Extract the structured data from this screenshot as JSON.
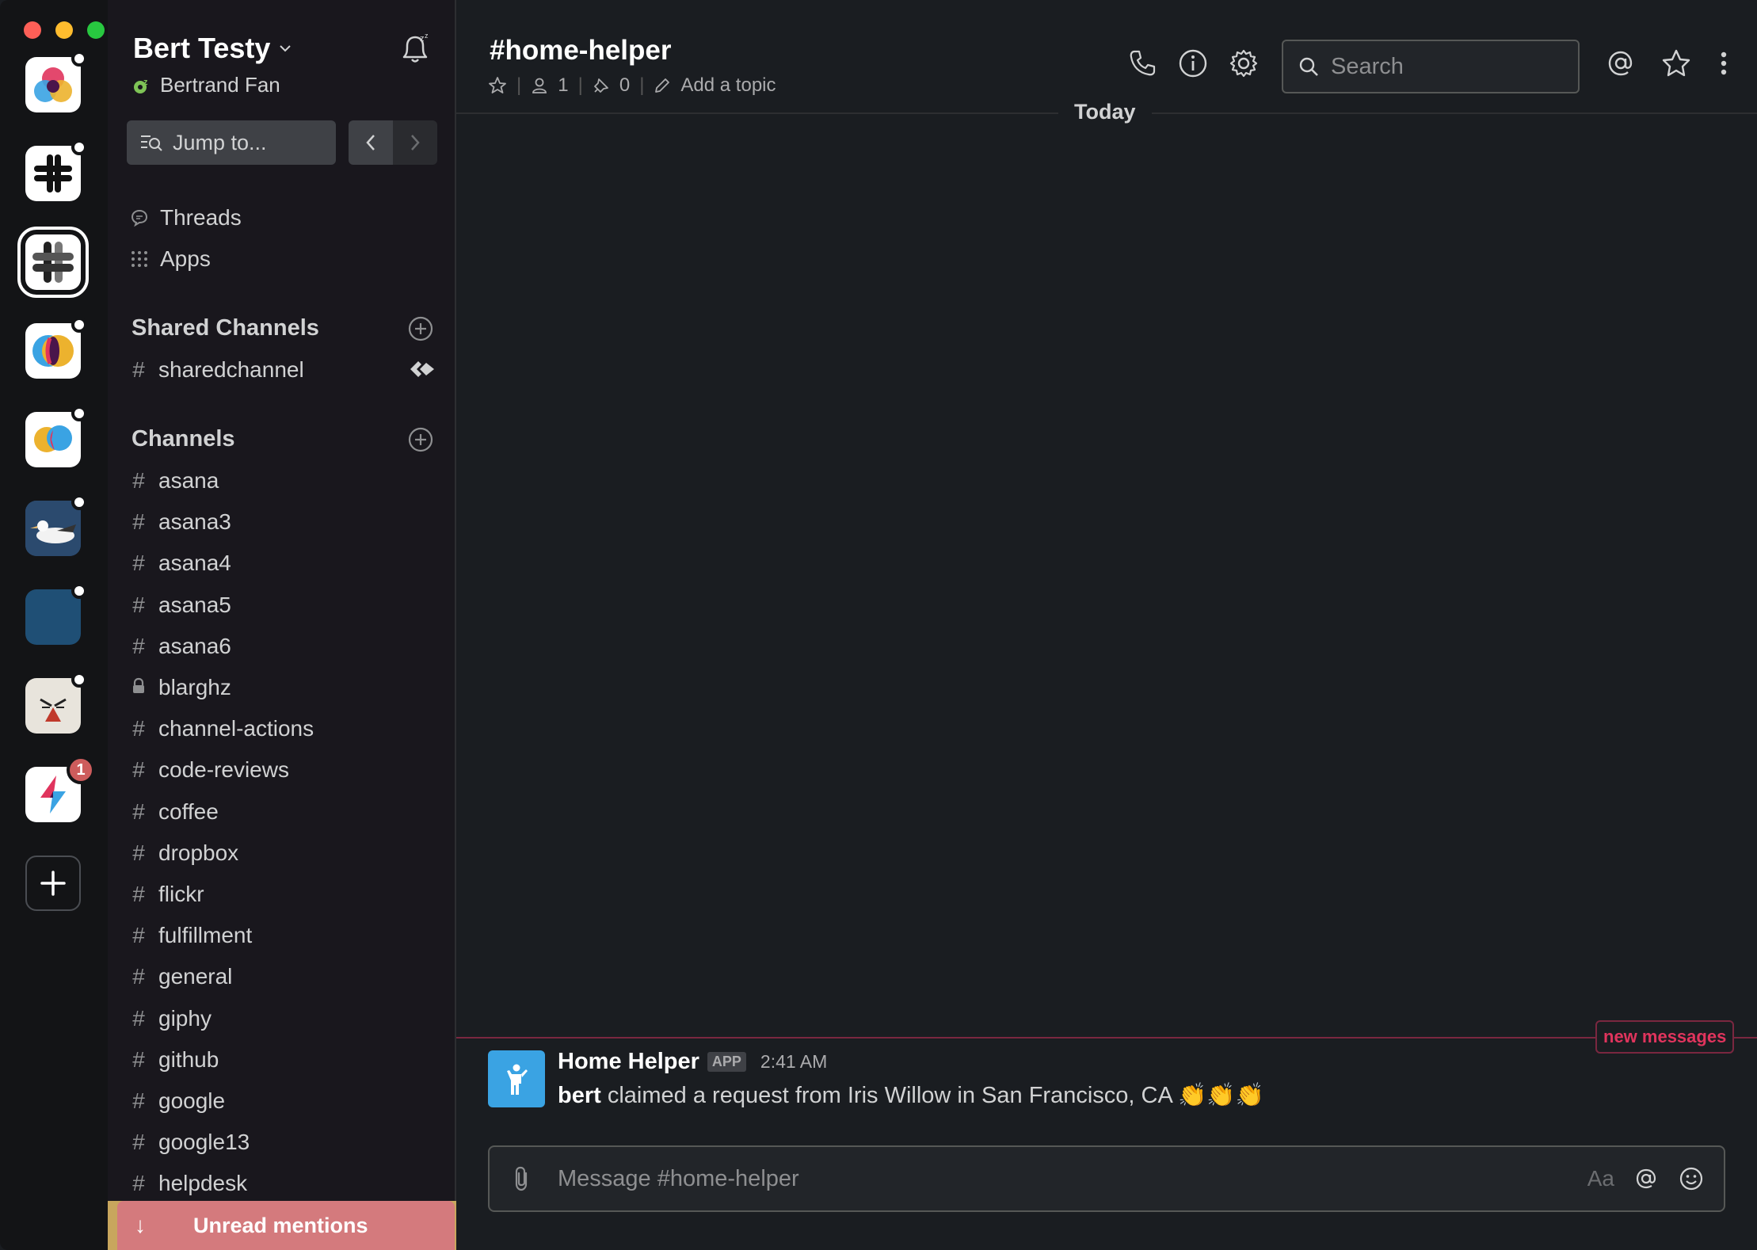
{
  "workspace": {
    "team_name": "Bert Testy",
    "user_name": "Bertrand Fan",
    "jump_to": "Jump to...",
    "badge_count": "1"
  },
  "sidebar": {
    "threads": "Threads",
    "apps": "Apps",
    "shared_header": "Shared Channels",
    "shared_channels": [
      "sharedchannel"
    ],
    "channels_header": "Channels",
    "channels": [
      {
        "name": "asana",
        "private": false
      },
      {
        "name": "asana3",
        "private": false
      },
      {
        "name": "asana4",
        "private": false
      },
      {
        "name": "asana5",
        "private": false
      },
      {
        "name": "asana6",
        "private": false
      },
      {
        "name": "blarghz",
        "private": true
      },
      {
        "name": "channel-actions",
        "private": false
      },
      {
        "name": "code-reviews",
        "private": false
      },
      {
        "name": "coffee",
        "private": false
      },
      {
        "name": "dropbox",
        "private": false
      },
      {
        "name": "flickr",
        "private": false
      },
      {
        "name": "fulfillment",
        "private": false
      },
      {
        "name": "general",
        "private": false
      },
      {
        "name": "giphy",
        "private": false
      },
      {
        "name": "github",
        "private": false
      },
      {
        "name": "google",
        "private": false
      },
      {
        "name": "google13",
        "private": false
      },
      {
        "name": "helpdesk",
        "private": false
      }
    ],
    "unread_mentions": "Unread mentions"
  },
  "channel": {
    "title": "#home-helper",
    "members": "1",
    "pins": "0",
    "add_topic": "Add a topic",
    "search_placeholder": "Search",
    "day_divider": "Today",
    "new_messages": "new messages"
  },
  "message": {
    "sender": "Home Helper",
    "badge": "APP",
    "time": "2:41 AM",
    "user": "bert",
    "text": "claimed a request from Iris Willow in San Francisco, CA",
    "emoji": "👏👏👏"
  },
  "composer": {
    "placeholder": "Message #home-helper",
    "format_label": "Aa"
  },
  "colors": {
    "rail_bg": "#131416",
    "sidebar_bg": "#19171d",
    "main_bg": "#1a1d21",
    "accent_red": "#e0345d",
    "unread_bg": "#d47a7d",
    "avatar_blue": "#3aa3e3",
    "presence_green": "#7ec356"
  }
}
